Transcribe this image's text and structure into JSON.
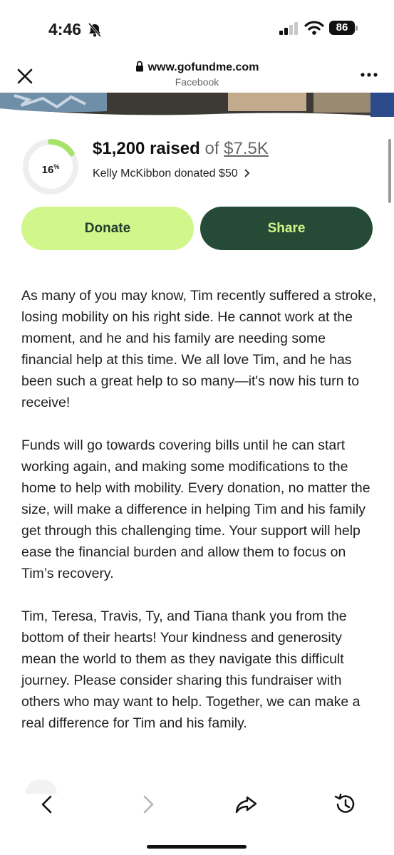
{
  "status_bar": {
    "time": "4:46",
    "battery": "86"
  },
  "browser": {
    "url": "www.gofundme.com",
    "source": "Facebook"
  },
  "campaign": {
    "percent": "16",
    "percent_value": 0.16,
    "raised": "$1,200 raised",
    "of": "of",
    "goal": "$7.5K",
    "recent_donation": "Kelly McKibbon donated $50"
  },
  "actions": {
    "donate_label": "Donate",
    "share_label": "Share"
  },
  "story": [
    "As many of you may know, Tim recently suffered a stroke, losing mobility on his right side. He cannot work at the moment, and he and his family are needing some financial help at this time. We all love Tim, and he has been such a great help to so many—it's now his turn to receive!",
    "Funds will go towards covering bills until he can start working again, and making some modifications to the home to help with mobility. Every donation, no matter the size, will make a difference in helping Tim and his family get through this challenging time. Your support will help ease the financial burden and allow them to focus on Tim’s recovery.",
    "Tim, Teresa, Travis, Ty, and Tiana thank you from the bottom of their hearts! Your kindness and generosity mean the world to them as they navigate this difficult journey. Please consider sharing this fundraiser with others who may want to help. Together, we can make a real difference for Tim and his family."
  ],
  "toolbar": {
    "icons": [
      "back-icon",
      "forward-icon",
      "share-icon",
      "history-icon"
    ]
  },
  "colors": {
    "donate_bg": "#d1f68c",
    "share_bg": "#254a35",
    "progress": "#a6e36b",
    "track": "#eeeeee"
  }
}
